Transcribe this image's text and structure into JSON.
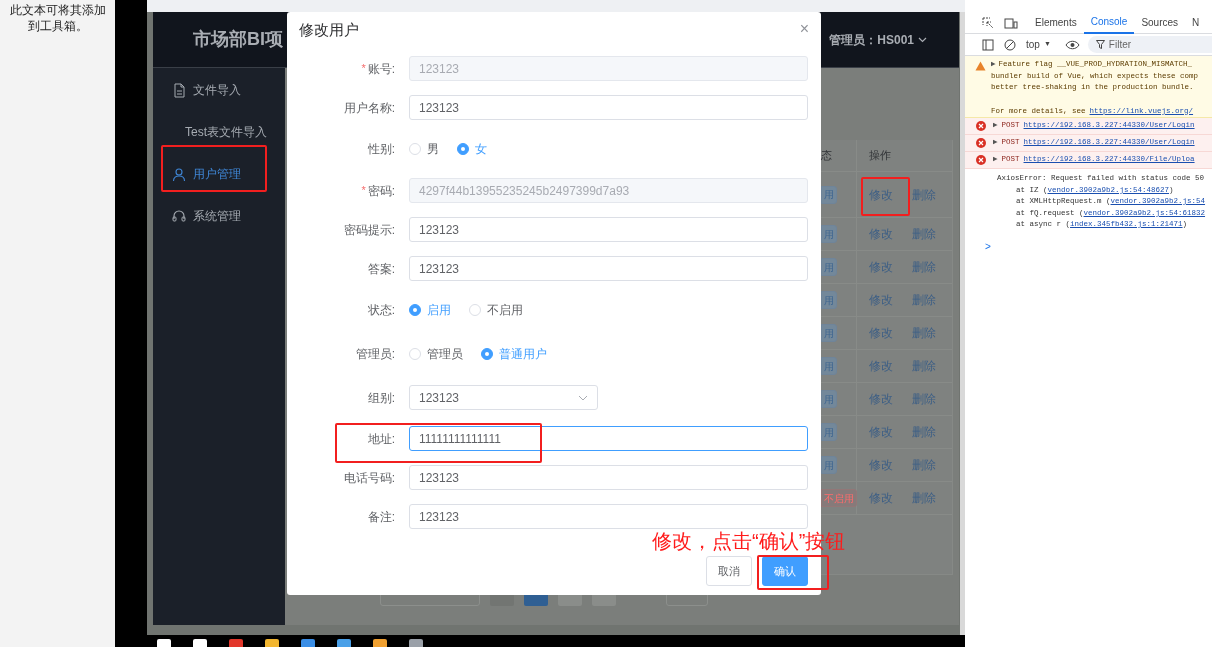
{
  "toolbox_hint": "此文本可将其添加到工具箱。",
  "app": {
    "title": "市场部BI项",
    "user_menu": "管理员：HS001",
    "sidebar": [
      {
        "label": "文件导入",
        "kind": "group",
        "selected": false
      },
      {
        "label": "Test表文件导入",
        "kind": "sub",
        "selected": false
      },
      {
        "label": "用户管理",
        "kind": "item",
        "selected": true
      },
      {
        "label": "系统管理",
        "kind": "group",
        "selected": false
      }
    ],
    "table": {
      "columns": [
        "态",
        "操作"
      ],
      "rows": [
        {
          "status": "用",
          "enabled": true,
          "actions": [
            "修改",
            "删除"
          ]
        },
        {
          "status": "用",
          "enabled": true,
          "actions": [
            "修改",
            "删除"
          ]
        },
        {
          "status": "用",
          "enabled": true,
          "actions": [
            "修改",
            "删除"
          ]
        },
        {
          "status": "用",
          "enabled": true,
          "actions": [
            "修改",
            "删除"
          ]
        },
        {
          "status": "用",
          "enabled": true,
          "actions": [
            "修改",
            "删除"
          ]
        },
        {
          "status": "用",
          "enabled": true,
          "actions": [
            "修改",
            "删除"
          ]
        },
        {
          "status": "用",
          "enabled": true,
          "actions": [
            "修改",
            "删除"
          ]
        },
        {
          "status": "用",
          "enabled": true,
          "actions": [
            "修改",
            "删除"
          ]
        },
        {
          "status": "用",
          "enabled": true,
          "actions": [
            "修改",
            "删除"
          ]
        },
        {
          "status": "不启用",
          "enabled": false,
          "actions": [
            "修改",
            "删除"
          ]
        }
      ]
    }
  },
  "dialog": {
    "title": "修改用户",
    "close": "×",
    "fields": [
      {
        "kind": "text",
        "label": "账号:",
        "value": "123123",
        "required_mark": "*",
        "disabled": true,
        "focused": false
      },
      {
        "kind": "text",
        "label": "用户名称:",
        "value": "123123",
        "disabled": false,
        "focused": false
      },
      {
        "kind": "radio",
        "label": "性别:",
        "options": [
          {
            "label": "男",
            "selected": false
          },
          {
            "label": "女",
            "selected": true
          }
        ]
      },
      {
        "kind": "text",
        "label": "密码:",
        "value": "4297f44b13955235245b2497399d7a93",
        "required_mark": "*",
        "disabled": true,
        "focused": false
      },
      {
        "kind": "text",
        "label": "密码提示:",
        "value": "123123",
        "disabled": false,
        "focused": false
      },
      {
        "kind": "text",
        "label": "答案:",
        "value": "123123",
        "disabled": false,
        "focused": false
      },
      {
        "kind": "radio",
        "label": "状态:",
        "options": [
          {
            "label": "启用",
            "selected": true
          },
          {
            "label": "不启用",
            "selected": false
          }
        ]
      },
      {
        "kind": "radio",
        "label": "管理员:",
        "options": [
          {
            "label": "管理员",
            "selected": false
          },
          {
            "label": "普通用户",
            "selected": true
          }
        ]
      },
      {
        "kind": "select",
        "label": "组别:",
        "value": "123123",
        "disabled": false,
        "focused": false
      },
      {
        "kind": "text",
        "label": "地址:",
        "value": "11111111111111",
        "disabled": false,
        "focused": true
      },
      {
        "kind": "text",
        "label": "电话号码:",
        "value": "123123",
        "disabled": false,
        "focused": false
      },
      {
        "kind": "text",
        "label": "备注:",
        "value": "123123",
        "disabled": false,
        "focused": false
      }
    ],
    "buttons": [
      {
        "label": "取消",
        "kind": "default"
      },
      {
        "label": "确认",
        "kind": "primary"
      }
    ]
  },
  "callout": "修改，点击“确认”按钮",
  "devtools": {
    "tabs": [
      {
        "label": "Elements",
        "selected": false
      },
      {
        "label": "Console",
        "selected": true
      },
      {
        "label": "Sources",
        "selected": false
      },
      {
        "label": "N",
        "selected": false
      }
    ],
    "context": "top",
    "context_caret": "▼",
    "filter_placeholder": "Filter",
    "messages": [
      {
        "kind": "warning",
        "toggle": "▶",
        "lines": [
          "Feature flag __VUE_PROD_HYDRATION_MISMATCH_",
          "bundler build of Vue, which expects these comp",
          "better tree-shaking in the production bundle."
        ],
        "details": "For more details, see",
        "link": "https://link.vuejs.org/"
      },
      {
        "kind": "error",
        "toggle": "▶",
        "method": "POST",
        "link": "https://192.168.3.227:44330/User/Login"
      },
      {
        "kind": "error",
        "toggle": "▶",
        "method": "POST",
        "link": "https://192.168.3.227:44330/User/Login"
      },
      {
        "kind": "error",
        "toggle": "▶",
        "method": "POST",
        "link": "https://192.168.3.227:44330/File/Uploa"
      },
      {
        "kind": "log",
        "text": "AxiosError: Request failed with status code 50",
        "stack": [
          {
            "prefix": "at IZ (",
            "link": "vendor.3902a9b2.js:54:48627",
            "suffix": ")"
          },
          {
            "prefix": "at XMLHttpRequest.m (",
            "link": "vendor.3902a9b2.js:54"
          },
          {
            "prefix": "at fQ.request (",
            "link": "vendor.3902a9b2.js:54:61832"
          },
          {
            "prefix": "at async r (",
            "link": "index.345fb432.js:1:21471",
            "suffix": ")"
          }
        ]
      }
    ],
    "prompt": ">"
  }
}
